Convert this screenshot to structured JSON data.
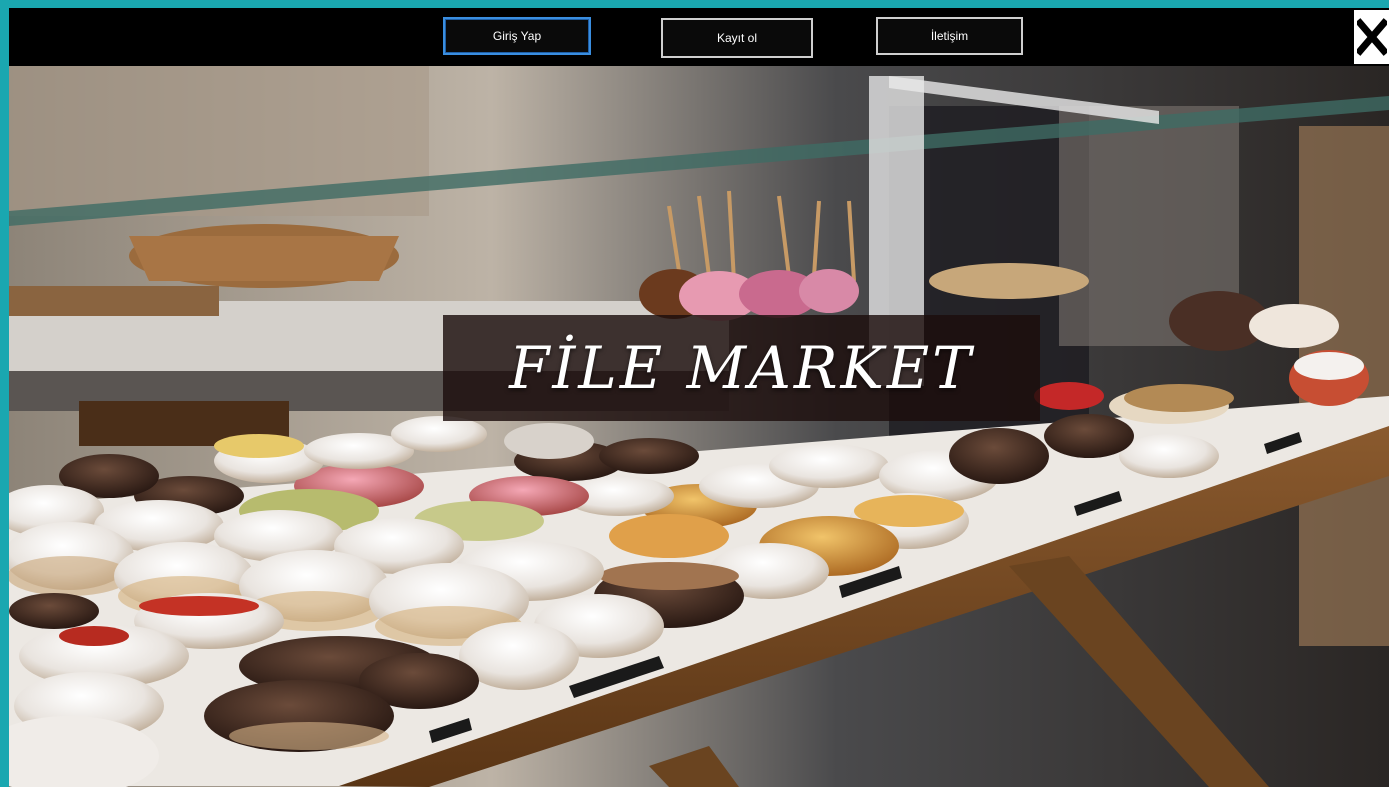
{
  "nav": {
    "login_label": "Giriş Yap",
    "register_label": "Kayıt ol",
    "contact_label": "İletişim"
  },
  "close": {
    "icon": "close-icon",
    "glyph": "X"
  },
  "banner": {
    "title": "FİLE MARKET"
  },
  "colors": {
    "frame": "#1aa7b0",
    "topbar": "#000000",
    "active_border": "#3a8ee0"
  }
}
